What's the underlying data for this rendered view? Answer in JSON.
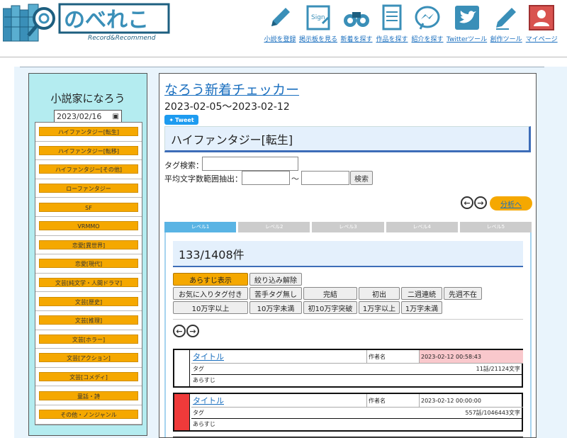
{
  "header": {
    "logo_text": "のべれこ",
    "logo_subtitle": "Record&Recommend",
    "nav": [
      {
        "label": "小説を登録",
        "icon": "pencil-icon"
      },
      {
        "label": "掲示板を見る",
        "icon": "sign-board-icon"
      },
      {
        "label": "新着を探す",
        "icon": "binoculars-icon"
      },
      {
        "label": "作品を探す",
        "icon": "document-icon"
      },
      {
        "label": "紹介を探す",
        "icon": "messenger-icon"
      },
      {
        "label": "Twitterツール",
        "icon": "twitter-icon"
      },
      {
        "label": "創作ツール",
        "icon": "pencil-icon"
      },
      {
        "label": "マイページ",
        "icon": "user-icon"
      }
    ]
  },
  "sidebar": {
    "title": "小説家になろう",
    "date": "2023/02/16",
    "items": [
      "ハイファンタジー[転生]",
      "ハイファンタジー[転移]",
      "ハイファンタジー[その他]",
      "ローファンタジー",
      "SF",
      "VRMMO",
      "恋愛[異世界]",
      "恋愛[現代]",
      "文芸[純文学・人間ドラマ]",
      "文芸[歴史]",
      "文芸[推理]",
      "文芸[ホラー]",
      "文芸[アクション]",
      "文芸[コメディ]",
      "童話・詩",
      "その他・ノンジャンル"
    ]
  },
  "main": {
    "title": "なろう新着チェッカー",
    "range": "2023-02-05～2023-02-12",
    "tweet_label": "Tweet",
    "genre": "ハイファンタジー[転生]",
    "tag_search_label": "タグ検索：",
    "avg_label": "平均文字数範囲抽出：",
    "tilde": "〜",
    "search_button": "検索",
    "analysis_button": "分析へ",
    "levels": [
      "レベル1",
      "レベル2",
      "レベル3",
      "レベル4",
      "レベル5"
    ],
    "count": "133/1408件",
    "filters": {
      "row1": [
        "あらすじ表示",
        "絞り込み解除"
      ],
      "row2": [
        "お気に入りタグ付き",
        "苦手タグ無し",
        "完結",
        "初出",
        "二週連続",
        "先週不在"
      ],
      "row3": [
        "10万字以上",
        "10万字未満",
        "初10万字突破",
        "1万字以上",
        "1万字未満"
      ]
    },
    "rows": [
      {
        "title": "タイトル",
        "author": "作者名",
        "date": "2023-02-12 00:58:43",
        "tag": "タグ",
        "stat": "11話/21124文字",
        "synopsis": "あらすじ",
        "side_color": "#ffffff",
        "date_bg": "#f9c8cc"
      },
      {
        "title": "タイトル",
        "author": "作者名",
        "date": "2023-02-12 00:00:00",
        "tag": "タグ",
        "stat": "557話/1046443文字",
        "synopsis": "あらすじ",
        "side_color": "#ef3a3a",
        "date_bg": "#ffffff"
      }
    ]
  },
  "colors": {
    "accent_orange": "#f5a800",
    "link_blue": "#1a6fbf",
    "sidebar_bg": "#b4ecf0",
    "tab_active": "#5ab4e4"
  }
}
